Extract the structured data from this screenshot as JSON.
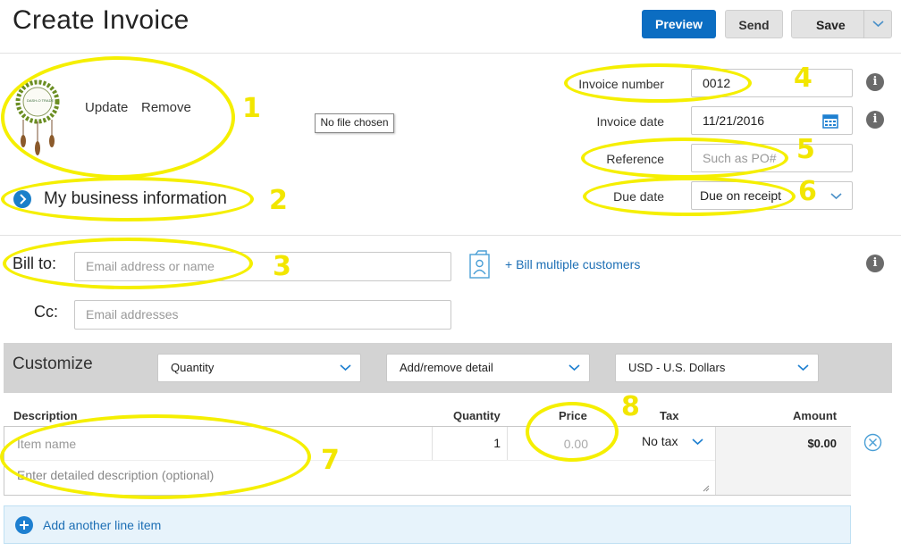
{
  "header": {
    "title": "Create Invoice",
    "preview_label": "Preview",
    "send_label": "Send",
    "save_label": "Save"
  },
  "logo_section": {
    "update_label": "Update",
    "remove_label": "Remove",
    "file_tooltip": "No file chosen",
    "logo_text": "DASH-O TRADE"
  },
  "business_info": {
    "label": "My business information"
  },
  "invoice_meta": {
    "invoice_number_label": "Invoice number",
    "invoice_number_value": "0012",
    "invoice_date_label": "Invoice date",
    "invoice_date_value": "11/21/2016",
    "reference_label": "Reference",
    "reference_placeholder": "Such as PO#",
    "due_date_label": "Due date",
    "due_date_value": "Due on receipt"
  },
  "recipients": {
    "bill_to_label": "Bill to:",
    "bill_to_placeholder": "Email address or name",
    "bill_multiple_label": "+ Bill multiple customers",
    "cc_label": "Cc:",
    "cc_placeholder": "Email addresses"
  },
  "customize": {
    "label": "Customize",
    "quantity_option": "Quantity",
    "detail_option": "Add/remove detail",
    "currency_option": "USD - U.S. Dollars"
  },
  "line_items": {
    "columns": {
      "description": "Description",
      "quantity": "Quantity",
      "price": "Price",
      "tax": "Tax",
      "amount": "Amount"
    },
    "item_placeholder": "Item name",
    "description_placeholder": "Enter detailed description (optional)",
    "quantity_value": "1",
    "price_placeholder": "0.00",
    "tax_value": "No tax",
    "amount_value": "$0.00",
    "add_line_label": "Add another line item"
  },
  "annotations": [
    "1",
    "2",
    "3",
    "4",
    "5",
    "6",
    "7",
    "8"
  ],
  "colors": {
    "primary": "#0b6dc2",
    "highlight": "#f5ef00",
    "link": "#1d6fb5"
  }
}
